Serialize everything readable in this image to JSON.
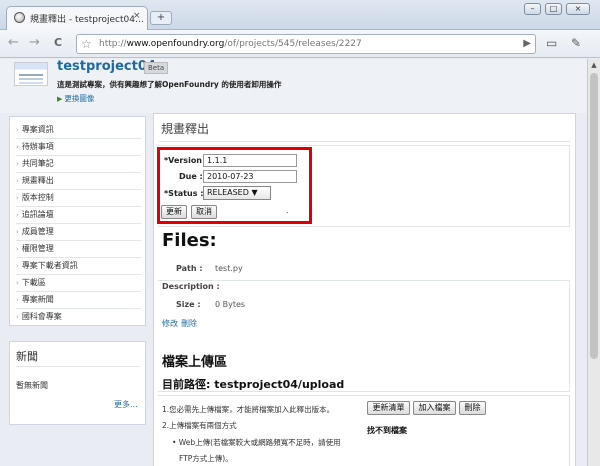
{
  "browser": {
    "tab_title": "規畫釋出 - testproject04…",
    "tab_close": "×",
    "new_tab": "+",
    "url_prefix": "http://",
    "url_domain": "www.openfoundry.org",
    "url_path": "/of/projects/545/releases/2227",
    "window_buttons": [
      "–",
      "□",
      "×"
    ],
    "icons": {
      "back": "←",
      "forward": "→",
      "reload": "C",
      "star": "☆",
      "go": "▶",
      "page": "▭",
      "wrench": "✎"
    }
  },
  "project": {
    "name": "testproject04",
    "badge": "Beta",
    "description": "這是測試專案，供有興趣想了解OpenFoundry 的使用者卸用操作",
    "change_image": "更換圖像"
  },
  "sidebar": {
    "items": [
      {
        "label": "專案資訊"
      },
      {
        "label": "待辦事項"
      },
      {
        "label": "共同筆記"
      },
      {
        "label": "規畫釋出"
      },
      {
        "label": "版本控制"
      },
      {
        "label": "追訊論壇"
      },
      {
        "label": "成員管理"
      },
      {
        "label": "權限管理"
      },
      {
        "label": "專案下載者資訊"
      },
      {
        "label": "下載區"
      },
      {
        "label": "專案新聞"
      },
      {
        "label": "國科會專案"
      }
    ]
  },
  "news": {
    "title": "新聞",
    "empty": "暫無新聞",
    "more": "更多..."
  },
  "main": {
    "title": "規畫釋出",
    "form": {
      "version_label": "*Version :",
      "version_value": "1.1.1",
      "due_label": "Due :",
      "due_value": "2010-07-23",
      "status_label": "*Status :",
      "status_value": "RELEASED",
      "status_arrow": "▼",
      "update_button": "更新",
      "cancel_button": "取消",
      "dot": "."
    },
    "files": {
      "heading": "Files:",
      "path_label": "Path :",
      "path_value": "test.py",
      "description_label": "Description :",
      "size_label": "Size :",
      "size_value": "0 Bytes",
      "edit_link": "修改",
      "delete_link": "刪除"
    },
    "upload": {
      "heading": "檔案上傳區",
      "path_heading": "目前路徑: testproject04/upload",
      "step1": "1.您必需先上傳檔案，才能將檔案加入此釋出版本。",
      "refresh_button": "更新清單",
      "add_button": "加入檔案",
      "delete_button": "刪除",
      "step2": "2.上傳檔案有兩個方式",
      "web_upload_1": "• Web上傳(若檔案較大或網路頻寬不足時，請使用",
      "web_upload_2": "FTP方式上傳)。",
      "not_found": "找不到檔案"
    }
  }
}
